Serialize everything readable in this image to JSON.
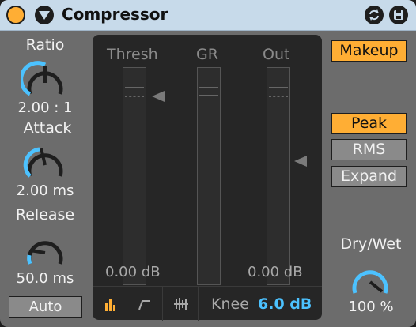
{
  "device": {
    "title": "Compressor",
    "accent_color": "#ffae34",
    "value_color": "#4cc2ff"
  },
  "ratio": {
    "label": "Ratio",
    "value": "2.00 : 1"
  },
  "attack": {
    "label": "Attack",
    "value": "2.00 ms"
  },
  "release": {
    "label": "Release",
    "value": "50.0 ms",
    "auto_label": "Auto"
  },
  "display": {
    "thresh_label": "Thresh",
    "gr_label": "GR",
    "out_label": "Out",
    "thresh_db": "0.00 dB",
    "out_db": "0.00 dB",
    "knee_label": "Knee",
    "knee_value": "6.0 dB"
  },
  "modes": {
    "makeup": "Makeup",
    "peak": "Peak",
    "rms": "RMS",
    "expand": "Expand"
  },
  "drywet": {
    "label": "Dry/Wet",
    "value": "100 %"
  }
}
